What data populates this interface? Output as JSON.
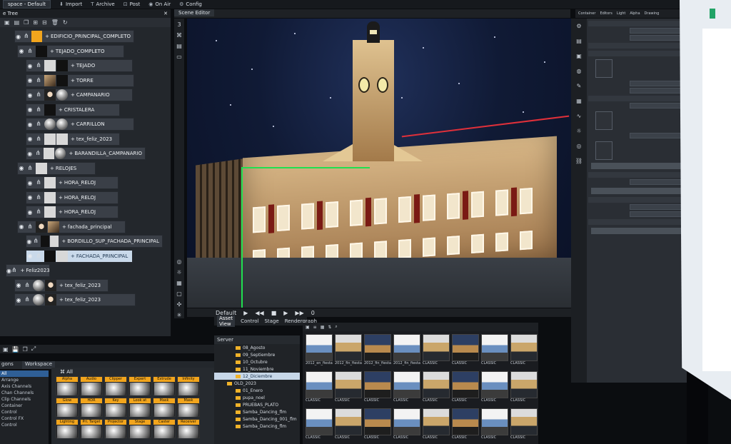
{
  "menubar": {
    "workspace": "space - Default",
    "items": [
      {
        "icon": "import-icon",
        "label": "Import"
      },
      {
        "icon": "archive-icon",
        "label": "Archive"
      },
      {
        "icon": "post-icon",
        "label": "Post"
      },
      {
        "icon": "on-air-icon",
        "label": "On Air"
      },
      {
        "icon": "gear-icon",
        "label": "Config"
      }
    ]
  },
  "scene_tree": {
    "title": "e Tree",
    "nodes": [
      {
        "label": "EDIFICIO_PRINCIPAL_COMPLETO"
      },
      {
        "label": "TEJADO_COMPLETO"
      },
      {
        "label": "TEJADO"
      },
      {
        "label": "TORRE"
      },
      {
        "label": "CAMPANARIO"
      },
      {
        "label": "CRISTALERA"
      },
      {
        "label": "CARRILLON"
      },
      {
        "label": "tex_feliz_2023"
      },
      {
        "label": "BARANDILLA_CAMPANARIO"
      },
      {
        "label": "RELOJES"
      },
      {
        "label": "HORA_RELOJ"
      },
      {
        "label": "HORA_RELOJ"
      },
      {
        "label": "HORA_RELOJ"
      },
      {
        "label": "fachada_principal"
      },
      {
        "label": "BORDILLO_SUP_FACHADA_PRINCIPAL"
      },
      {
        "label": "FACHADA_PRINCIPAL"
      },
      {
        "label": "Feliz2023"
      },
      {
        "label": "tex_feliz_2023"
      },
      {
        "label": "tex_feliz_2023"
      }
    ]
  },
  "editor": {
    "tab": "Scene Editor",
    "layer_number": "3",
    "viewport_bar": [
      "Default",
      "▶",
      "◀◀",
      "■",
      "▶",
      "▶▶",
      "0"
    ]
  },
  "properties": {
    "tabs": [
      "Container",
      "Editors",
      "Light",
      "Alpha",
      "Drawing"
    ]
  },
  "library": {
    "tabs": [
      "gons",
      "Workspace"
    ],
    "categories": [
      "All",
      "Arrange",
      "Axis Channels",
      "Chan Channels",
      "Clip Channels",
      "Container",
      "Control",
      "Control FX",
      "Control"
    ],
    "filter": "All",
    "primitives": [
      {
        "label": "Alpha"
      },
      {
        "label": "Audio"
      },
      {
        "label": "Clipper"
      },
      {
        "label": "Expert"
      },
      {
        "label": "Extrude"
      },
      {
        "label": "Infinity"
      },
      {
        "label": "Glow"
      },
      {
        "label": "HDR"
      },
      {
        "label": "Key"
      },
      {
        "label": "Look at"
      },
      {
        "label": "Mask"
      },
      {
        "label": "Mask"
      },
      {
        "label": "Lighting"
      },
      {
        "label": "Pri. Target"
      },
      {
        "label": "Projector"
      },
      {
        "label": "Stage"
      },
      {
        "label": "Caster"
      },
      {
        "label": "Receiver"
      }
    ]
  },
  "asset_view": {
    "tabs": [
      "Asset View",
      "Control",
      "Stage",
      "Rendergraph"
    ],
    "server_label": "Server",
    "folders": [
      "08_Agosto",
      "09_Septiembre",
      "10_Octubre",
      "11_Noviembre",
      "12_Diciembre",
      "OLD_2023",
      "01_Enero",
      "pupa_noel",
      "PRUEBAS_PLATO",
      "Samba_Dancing_flm",
      "Samba_Dancing_001_flm",
      "Samba_Dancing_flm"
    ],
    "selected_folder": 4,
    "thumb_caption": "CLASSIC",
    "thumbs": [
      "2012_en_fiesta",
      "2012_fin_fiesta",
      "2012_fin_fiesta",
      "2012_fin_fiesta",
      "CLASSIC",
      "CLASSIC",
      "CLASSIC",
      "CLASSIC"
    ]
  },
  "colors": {
    "panel": "#23272c",
    "accent": "#f2a51d",
    "selection": "#c9d9ea",
    "guide_green": "#20e050",
    "guide_red": "#e0303a"
  }
}
